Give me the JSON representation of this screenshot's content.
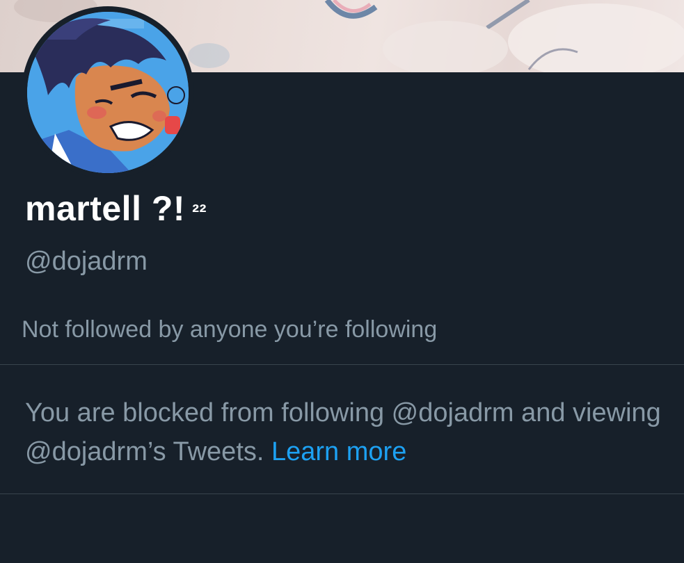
{
  "profile": {
    "display_name": "martell ?!",
    "display_name_sup": "²²",
    "handle": "@dojadrm",
    "followed_note": "Not followed by anyone you’re following"
  },
  "blocked_notice": {
    "text": "You are blocked from following @dojadrm and viewing @dojadrm’s Tweets.",
    "link_label": "Learn more"
  },
  "colors": {
    "background": "#17202a",
    "primary_text": "#ffffff",
    "secondary_text": "#8899a6",
    "link": "#1da1f2",
    "divider": "#38444d"
  },
  "images": {
    "banner": "header-banner-image",
    "avatar": "cartoon-character-avatar"
  }
}
